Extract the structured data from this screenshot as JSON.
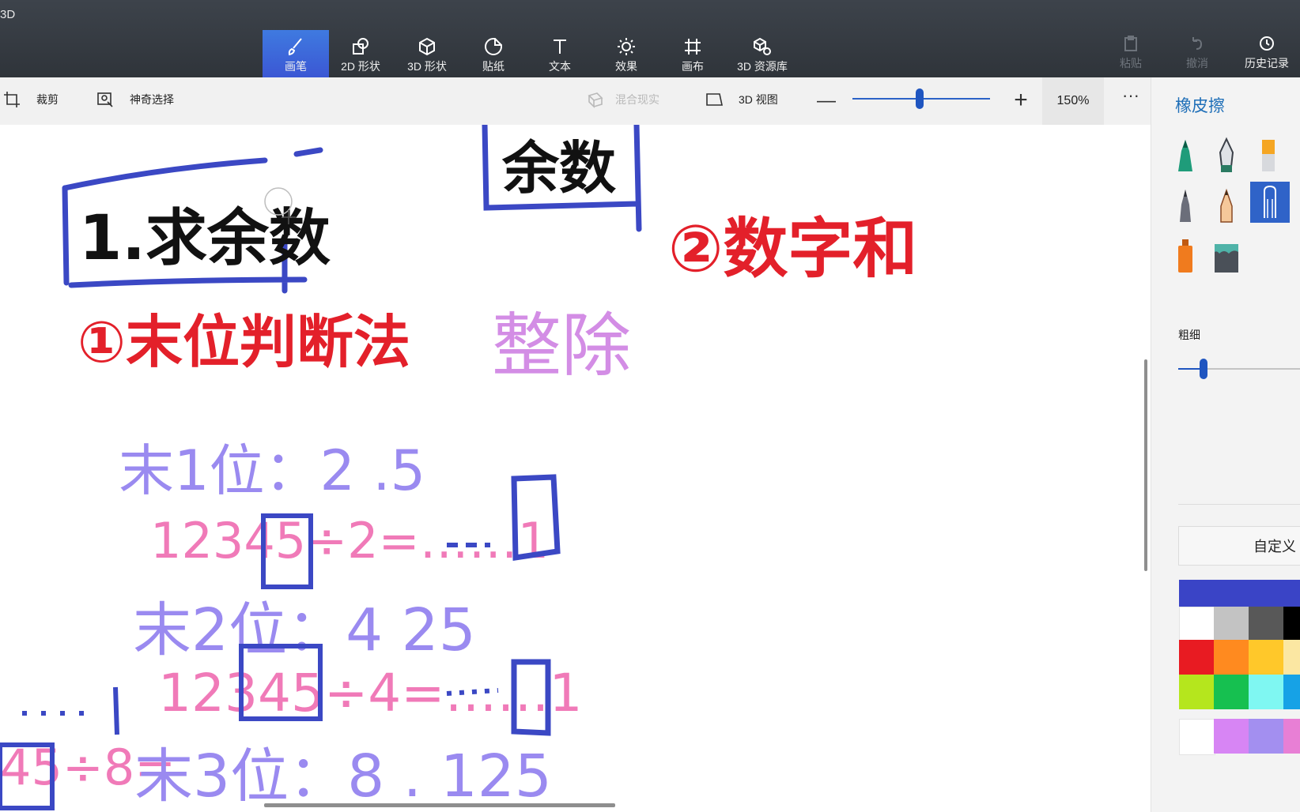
{
  "app": {
    "title": "3D"
  },
  "tabs": [
    {
      "label": "画笔",
      "icon": "brush-icon",
      "active": true
    },
    {
      "label": "2D 形状",
      "icon": "2d-shapes-icon"
    },
    {
      "label": "3D 形状",
      "icon": "3d-shapes-icon"
    },
    {
      "label": "贴纸",
      "icon": "sticker-icon"
    },
    {
      "label": "文本",
      "icon": "text-icon"
    },
    {
      "label": "效果",
      "icon": "effects-icon"
    },
    {
      "label": "画布",
      "icon": "canvas-icon"
    },
    {
      "label": "3D 资源库",
      "icon": "3d-library-icon"
    }
  ],
  "right_actions": {
    "paste": "粘贴",
    "undo": "撤消",
    "history": "历史记录"
  },
  "subtoolbar": {
    "crop": "裁剪",
    "magic_select": "神奇选择",
    "mixed_reality": "混合现实",
    "view_3d": "3D 视图",
    "zoom_minus": "—",
    "zoom_plus": "+",
    "zoom_value": "150%",
    "zoom_level_fraction": 0.49,
    "more": "···"
  },
  "panel": {
    "title": "橡皮擦",
    "brushes": [
      {
        "name": "marker",
        "color": "#1f9c7a"
      },
      {
        "name": "calligraphy-pen",
        "color": "#2a7a62"
      },
      {
        "name": "oil-brush",
        "color": "#f5a623"
      },
      {
        "name": "watercolor",
        "color": "#6b6e7a"
      },
      {
        "name": "pencil",
        "color": "#f0a060"
      },
      {
        "name": "eraser",
        "color": "#2f63c8",
        "selected": true
      },
      {
        "name": "spray-can",
        "color": "#f07b1e"
      },
      {
        "name": "fill-bucket",
        "color": "#4fb3a8"
      }
    ],
    "thickness_label": "粗细",
    "thickness_fraction": 0.2,
    "custom_label": "自定义",
    "current_color": "#3a44c6",
    "swatches": [
      [
        "#ffffff",
        "#c3c3c3",
        "#585858",
        "#000000"
      ],
      [
        "#e81b22",
        "#ff8a1f",
        "#ffc82a",
        "#fbe7a2"
      ],
      [
        "#b5e61d",
        "#16c050",
        "#7ff7f2",
        "#16a2e6"
      ],
      [
        "#ffffff",
        "#d785f4",
        "#a38ff0",
        "#e87fd5"
      ]
    ]
  },
  "canvas": {
    "labels": [
      {
        "text": "余数",
        "color": "#111111"
      },
      {
        "text": "1.求余数",
        "color": "#111111"
      },
      {
        "text": "②数字和",
        "color": "#e3202a"
      },
      {
        "text": "①末位判断法",
        "color": "#e3202a"
      },
      {
        "text": "整除",
        "color": "#d38de5"
      },
      {
        "text": "末1位：2 .5",
        "color": "#9a8af0"
      },
      {
        "text": "12345÷2=……1",
        "color": "#f07ab8"
      },
      {
        "text": "末2位：4 25",
        "color": "#9a8af0"
      },
      {
        "text": "12345÷4=……1",
        "color": "#f07ab8"
      },
      {
        "text": "45÷8=",
        "color": "#f07ab8"
      },
      {
        "text": "末3位：8 . 125",
        "color": "#9a8af0"
      }
    ]
  }
}
